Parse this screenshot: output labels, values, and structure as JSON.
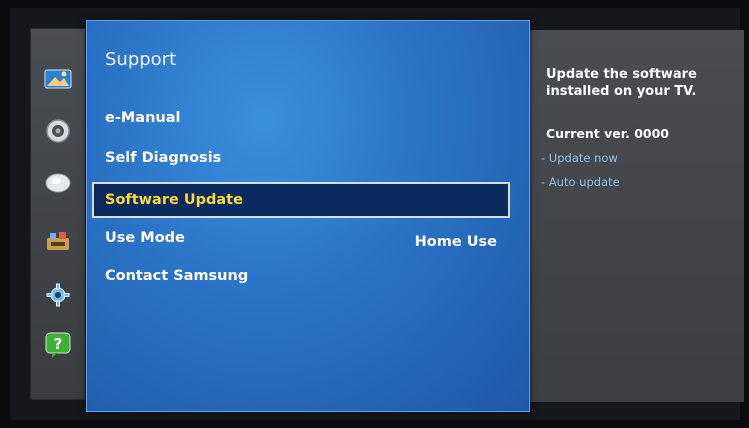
{
  "sidebar": {
    "items": [
      {
        "icon": "picture-icon"
      },
      {
        "icon": "sound-icon"
      },
      {
        "icon": "broadcasting-icon"
      },
      {
        "icon": "network-icon"
      },
      {
        "icon": "system-icon"
      },
      {
        "icon": "support-icon",
        "glyph": "?"
      }
    ]
  },
  "menu": {
    "title": "Support",
    "items": [
      {
        "label": "e-Manual"
      },
      {
        "label": "Self Diagnosis"
      },
      {
        "label": "Software Update",
        "selected": true
      },
      {
        "label": "Use Mode",
        "value": "Home Use"
      },
      {
        "label": "Contact Samsung"
      }
    ]
  },
  "info": {
    "description": "Update the software installed on your TV.",
    "current_version": "Current ver. 0000",
    "links": [
      "- Update now",
      "- Auto update"
    ]
  },
  "colors": {
    "panel_blue": "#2a72c6",
    "selected_bg": "#0c2a5e",
    "selected_text": "#ffd93a",
    "link_blue": "#8fc2ea",
    "sidebar_gray": "#45484c"
  }
}
